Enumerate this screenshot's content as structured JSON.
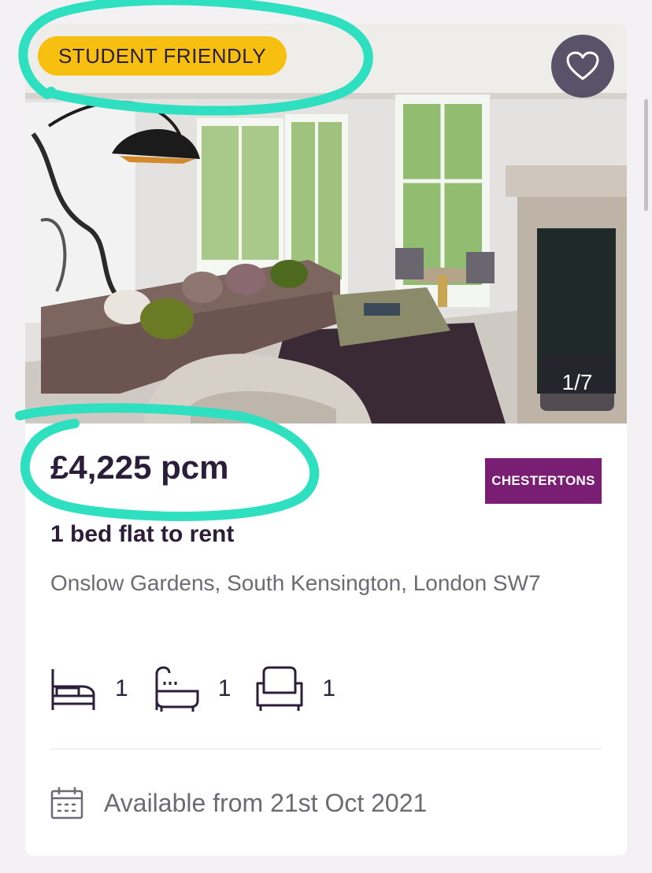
{
  "listing": {
    "badge": "STUDENT FRIENDLY",
    "photo_counter": "1/7",
    "price": "£4,225 pcm",
    "agent_logo": "CHESTERTONS",
    "title": "1 bed flat to rent",
    "address": "Onslow Gardens, South Kensington, London SW7",
    "features": [
      {
        "icon": "bed-icon",
        "count": "1"
      },
      {
        "icon": "bath-icon",
        "count": "1"
      },
      {
        "icon": "sofa-icon",
        "count": "1"
      }
    ],
    "availability": "Available from 21st Oct 2021"
  },
  "colors": {
    "badge": "#f7bf10",
    "highlight_annotation": "#2ee0c0",
    "agent_brand": "#7a1e74",
    "text_dark": "#2b1e3a",
    "text_muted": "#6b6b73"
  }
}
